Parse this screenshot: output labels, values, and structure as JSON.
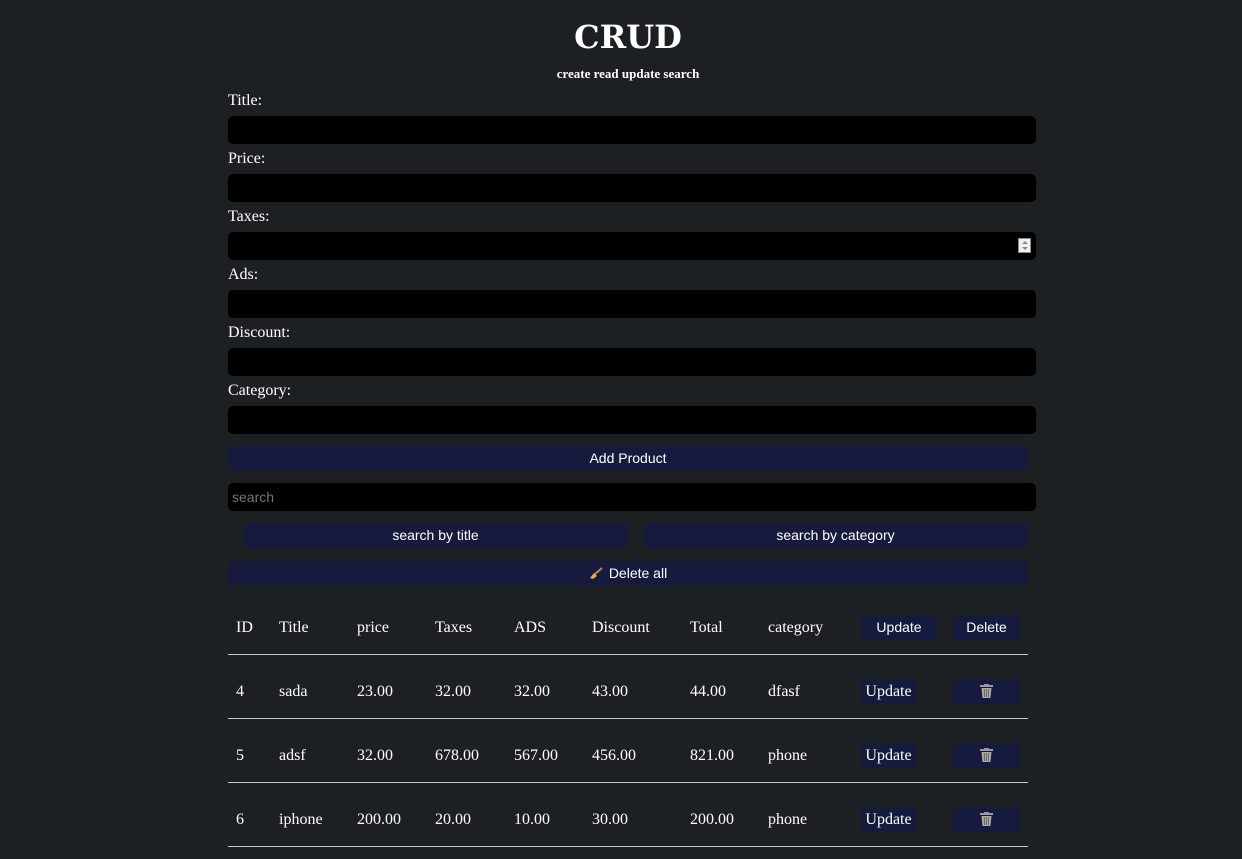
{
  "header": {
    "title": "CRUD",
    "subtitle": "create read update search"
  },
  "form": {
    "title_label": "Title:",
    "price_label": "Price:",
    "taxes_label": "Taxes:",
    "ads_label": "Ads:",
    "discount_label": "Discount:",
    "category_label": "Category:",
    "add_button": "Add Product"
  },
  "search": {
    "placeholder": "search",
    "by_title_button": "search by title",
    "by_category_button": "search by category"
  },
  "delete_all": {
    "label": "Delete all",
    "icon": "broom-icon"
  },
  "table": {
    "headers": {
      "id": "ID",
      "title": "Title",
      "price": "price",
      "taxes": "Taxes",
      "ads": "ADS",
      "discount": "Discount",
      "total": "Total",
      "category": "category",
      "update": "Update",
      "delete": "Delete"
    },
    "update_label": "Update",
    "delete_icon": "trash-icon",
    "rows": [
      {
        "id": "4",
        "title": "sada",
        "price": "23.00",
        "taxes": "32.00",
        "ads": "32.00",
        "discount": "43.00",
        "total": "44.00",
        "category": "dfasf"
      },
      {
        "id": "5",
        "title": "adsf",
        "price": "32.00",
        "taxes": "678.00",
        "ads": "567.00",
        "discount": "456.00",
        "total": "821.00",
        "category": "phone"
      },
      {
        "id": "6",
        "title": "iphone",
        "price": "200.00",
        "taxes": "20.00",
        "ads": "10.00",
        "discount": "30.00",
        "total": "200.00",
        "category": "phone"
      }
    ]
  },
  "colors": {
    "background": "#1d2022",
    "button": "#161a3d",
    "input": "#000000"
  }
}
